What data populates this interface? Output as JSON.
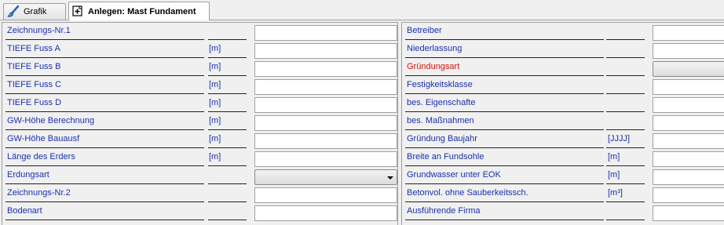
{
  "tabs": [
    {
      "label": "Grafik",
      "icon": "brush-icon",
      "active": false
    },
    {
      "label": "Anlegen: Mast Fundament",
      "icon": "add-record-icon",
      "active": true
    }
  ],
  "left_fields": [
    {
      "label": "Zeichnungs-Nr.1",
      "unit": "",
      "value": "",
      "type": "text"
    },
    {
      "label": "TIEFE Fuss A",
      "unit": "[m]",
      "value": "",
      "type": "text"
    },
    {
      "label": "TIEFE Fuss B",
      "unit": "[m]",
      "value": "",
      "type": "text"
    },
    {
      "label": "TIEFE Fuss C",
      "unit": "[m]",
      "value": "",
      "type": "text"
    },
    {
      "label": "TIEFE Fuss D",
      "unit": "[m]",
      "value": "",
      "type": "text"
    },
    {
      "label": "GW-Höhe  Berechnung",
      "unit": "[m]",
      "value": "",
      "type": "text"
    },
    {
      "label": "GW-Höhe Bauausf",
      "unit": "[m]",
      "value": "",
      "type": "text"
    },
    {
      "label": "Länge des Erders",
      "unit": "[m]",
      "value": "",
      "type": "text"
    },
    {
      "label": "Erdungsart",
      "unit": "",
      "value": "",
      "type": "select"
    },
    {
      "label": "Zeichnungs-Nr.2",
      "unit": "",
      "value": "",
      "type": "text"
    },
    {
      "label": "Bodenart",
      "unit": "",
      "value": "",
      "type": "text"
    }
  ],
  "right_fields": [
    {
      "label": "Betreiber",
      "unit": "",
      "value": "",
      "type": "text",
      "required": false
    },
    {
      "label": "Niederlassung",
      "unit": "",
      "value": "",
      "type": "text",
      "required": false
    },
    {
      "label": "Gründungsart",
      "unit": "",
      "value": "",
      "type": "select",
      "required": true
    },
    {
      "label": "Festigkeitsklasse",
      "unit": "",
      "value": "",
      "type": "text",
      "required": false
    },
    {
      "label": "bes. Eigenschafte",
      "unit": "",
      "value": "",
      "type": "text",
      "required": false
    },
    {
      "label": "bes. Maßnahmen",
      "unit": "",
      "value": "",
      "type": "text",
      "required": false
    },
    {
      "label": "Gründung Baujahr",
      "unit": "[JJJJ]",
      "value": "",
      "type": "text",
      "required": false
    },
    {
      "label": "Breite an Fundsohle",
      "unit": "[m]",
      "value": "",
      "type": "text",
      "required": false
    },
    {
      "label": "Grundwasser unter EOK",
      "unit": "[m]",
      "value": "",
      "type": "text",
      "required": false
    },
    {
      "label": "Betonvol. ohne Sauberkeitssch.",
      "unit": "[m³]",
      "value": "",
      "type": "text",
      "required": false
    },
    {
      "label": "Ausführende Firma",
      "unit": "",
      "value": "",
      "type": "text",
      "required": false
    }
  ],
  "colors": {
    "label": "#1a2fb0",
    "required_label": "#e01010",
    "background": "#f0f0f0",
    "field_border": "#a0a0a0"
  }
}
